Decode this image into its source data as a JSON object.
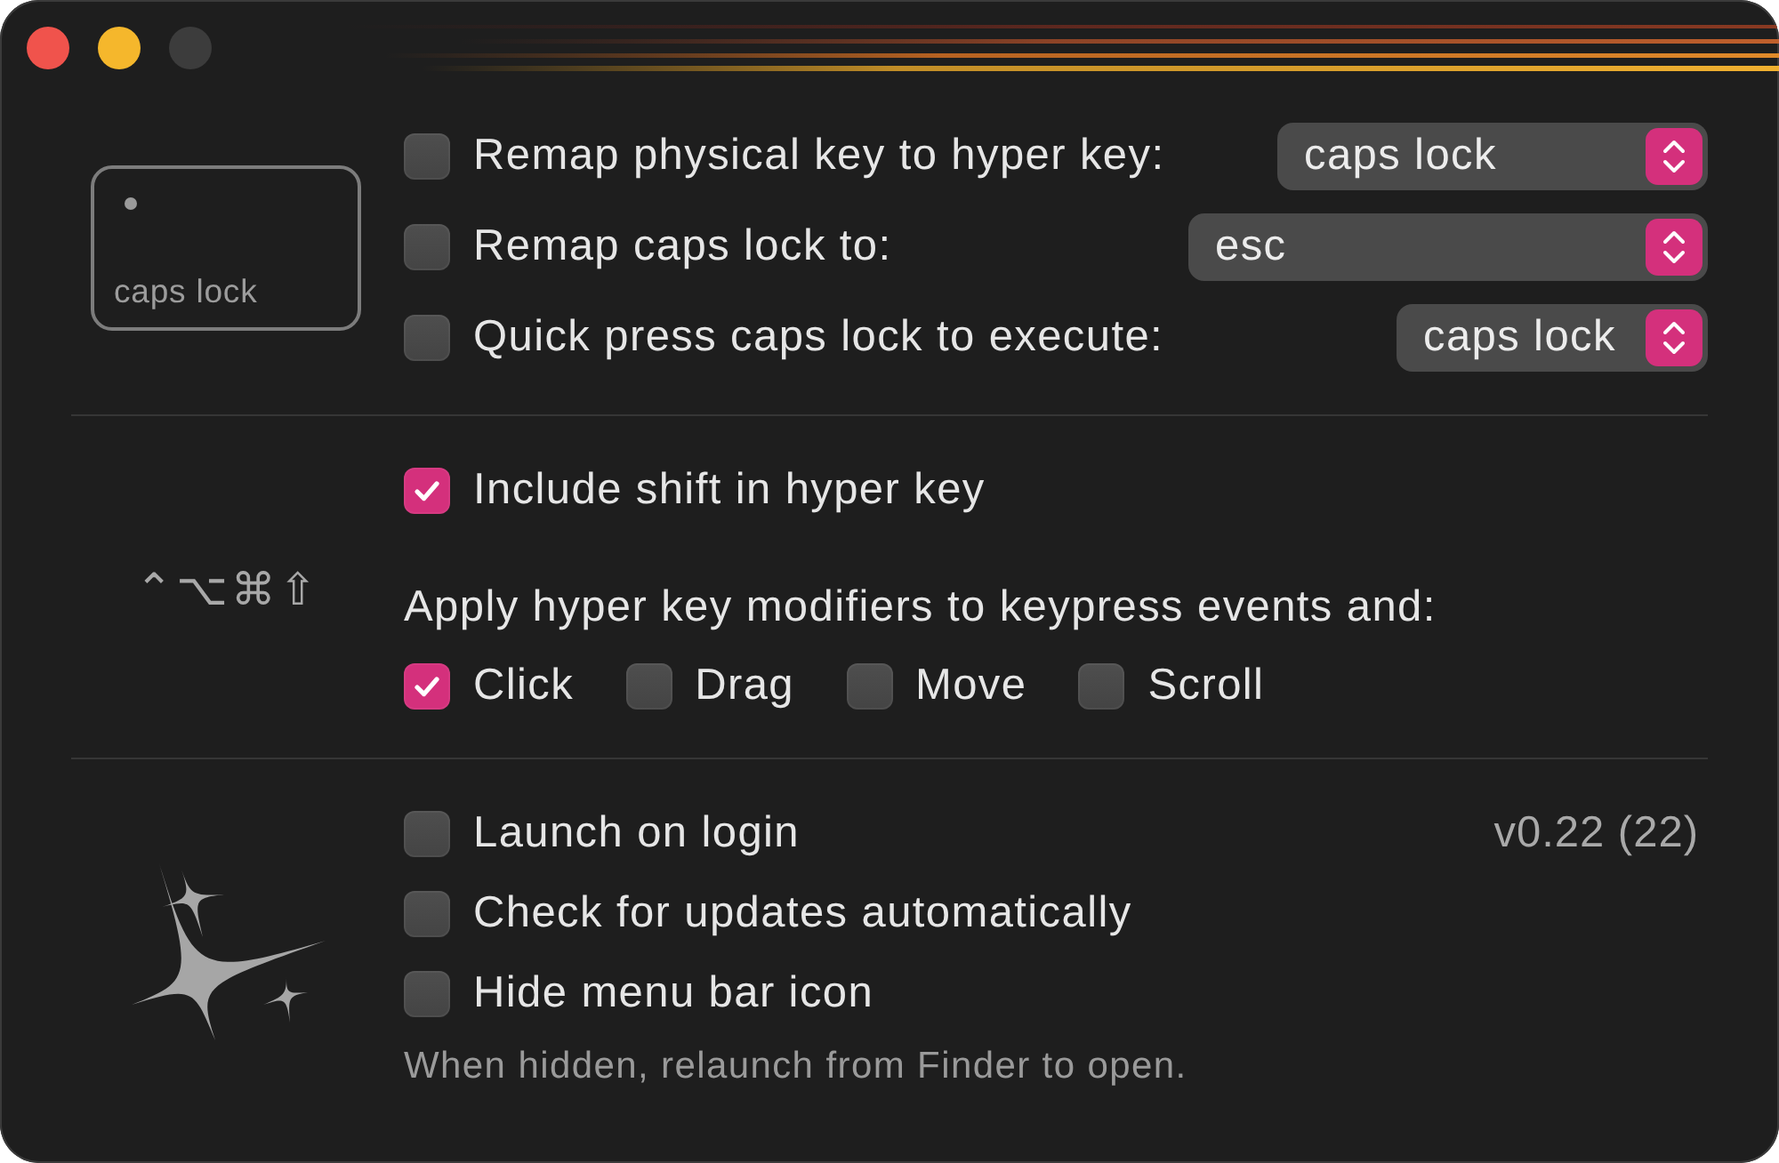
{
  "window_controls": [
    {
      "kind": "close",
      "disabled": false
    },
    {
      "kind": "minimize",
      "disabled": false
    },
    {
      "kind": "zoom",
      "disabled": true
    }
  ],
  "keyboard_section": {
    "key_preview": {
      "label": "caps lock"
    },
    "options": [
      {
        "label": "Remap physical key to hyper key:",
        "checked": false,
        "value": "caps lock"
      },
      {
        "label": "Remap caps lock to:",
        "checked": false,
        "value": "esc"
      },
      {
        "label": "Quick press caps lock to execute:",
        "checked": false,
        "value": "caps lock"
      }
    ]
  },
  "hyper_section": {
    "modifier_symbols": "⌃⌥⌘⇧",
    "include_shift": {
      "label": "Include shift in hyper key",
      "checked": true
    },
    "apply_label": "Apply hyper key modifiers to keypress events and:",
    "events": [
      {
        "label": "Click",
        "checked": true
      },
      {
        "label": "Drag",
        "checked": false
      },
      {
        "label": "Move",
        "checked": false
      },
      {
        "label": "Scroll",
        "checked": false
      }
    ]
  },
  "general_section": {
    "options": [
      {
        "label": "Launch on login",
        "checked": false
      },
      {
        "label": "Check for updates automatically",
        "checked": false
      },
      {
        "label": "Hide menu bar icon",
        "checked": false
      }
    ],
    "version": "v0.22 (22)",
    "note": "When hidden, relaunch from Finder to open."
  }
}
